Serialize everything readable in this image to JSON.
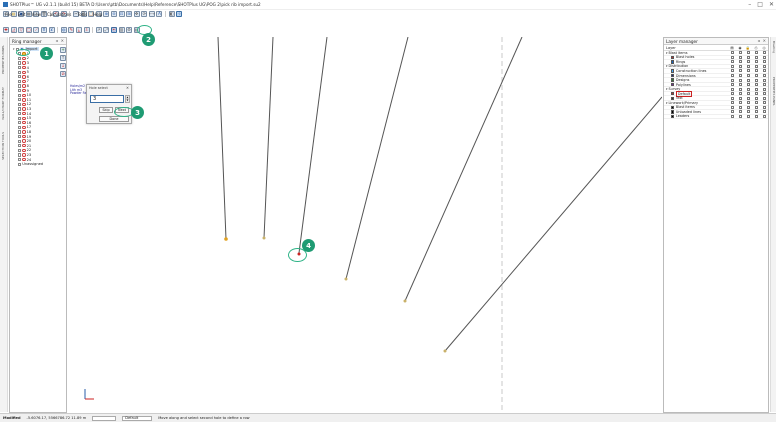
{
  "window": {
    "title": "SHOTPlus™ UG v2.1.1 (build 15) BETA D:\\Users\\ptb\\Documents\\Help\\Reference\\SHOTPlus UG\\POG 2\\pick rib import.su2"
  },
  "menu": [
    "File",
    "Edit",
    "View",
    "Calculations",
    "Tools",
    "Help"
  ],
  "ring_manager": {
    "title": "Ring manager",
    "root": "Import",
    "rings": [
      "1",
      "2",
      "3",
      "4",
      "5",
      "6",
      "7",
      "8",
      "9",
      "10",
      "11",
      "12",
      "13",
      "14",
      "15",
      "16",
      "17",
      "18",
      "19",
      "20",
      "21",
      "22",
      "23",
      "24"
    ],
    "unassigned": "Unassigned"
  },
  "left_tabs": [
    "PROPERTIES PANEL",
    "WALL/CHART FORMAT",
    "SELECTION TOOLS"
  ],
  "right_tabs": [
    "Blasting",
    "PROPERTIES PANEL"
  ],
  "dialog": {
    "title": "Hole select",
    "value": "3",
    "next": "Next",
    "skip": "Skip",
    "done": "Done"
  },
  "canvas_note": {
    "line1": "Holes/m2",
    "line2": "Lith m3",
    "line3": "Powder Factor"
  },
  "layer_manager": {
    "title": "Layer manager",
    "header_label": "Layer",
    "col_labels": [
      "Loc",
      "Vis",
      "Lck",
      "Ptr",
      "Sel"
    ],
    "rows": [
      {
        "name": "Blast items",
        "indent": 0,
        "group": true,
        "color": ""
      },
      {
        "name": "Blast holes",
        "indent": 1,
        "group": false,
        "color": "#c62828"
      },
      {
        "name": "Rings",
        "indent": 1,
        "group": false,
        "color": "#1565c0"
      },
      {
        "name": "Distribution",
        "indent": 0,
        "group": true,
        "color": ""
      },
      {
        "name": "Construction lines",
        "indent": 1,
        "group": false,
        "color": "#42a5f5"
      },
      {
        "name": "Dimensions",
        "indent": 1,
        "group": false,
        "color": "#1a237e"
      },
      {
        "name": "Designs",
        "indent": 1,
        "group": false,
        "color": "#2e7d32"
      },
      {
        "name": "Polylines",
        "indent": 1,
        "group": false,
        "color": "#7b1fa2"
      },
      {
        "name": "Survey",
        "indent": 0,
        "group": true,
        "color": ""
      },
      {
        "name": "Default",
        "indent": 1,
        "group": false,
        "color": "#c62828",
        "selected": true
      },
      {
        "name": "Text",
        "indent": 1,
        "group": false,
        "color": "#333333"
      },
      {
        "name": "Linework/Primary",
        "indent": 0,
        "group": true,
        "color": ""
      },
      {
        "name": "Blast items",
        "indent": 1,
        "group": false,
        "color": "#000000"
      },
      {
        "name": "Unloaded lines",
        "indent": 1,
        "group": false,
        "color": "#000000"
      },
      {
        "name": "Leaders",
        "indent": 1,
        "group": false,
        "color": "#000000"
      }
    ]
  },
  "status": {
    "mode": "Modified",
    "coords": "-5.6076.17, 5566786.72  11.89 m",
    "layer": "Default",
    "hint": "Move along and select second hole to define a row"
  },
  "callouts": [
    "1",
    "2",
    "3",
    "4"
  ],
  "colors": {
    "callout": "#1f9b73",
    "highlight": "#2fb387",
    "hole_line": "#555555",
    "hole_collar": "#e0a020"
  }
}
